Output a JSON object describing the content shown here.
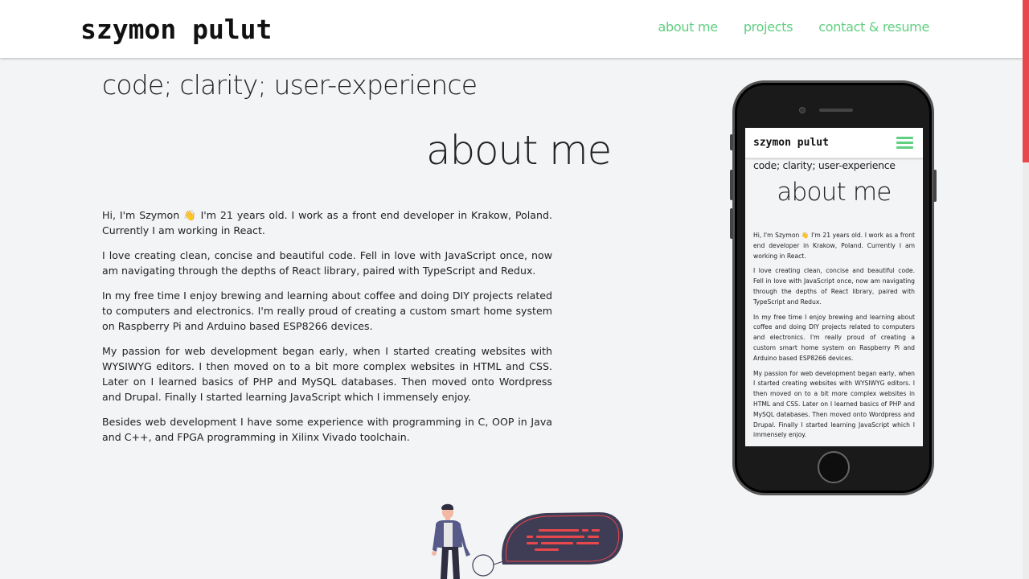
{
  "header": {
    "logo": "szymon pulut",
    "nav": [
      {
        "label": "about me"
      },
      {
        "label": "projects"
      },
      {
        "label": "contact & resume"
      }
    ]
  },
  "main": {
    "tagline": "code; clarity; user-experience",
    "section_title": "about me",
    "paragraphs": [
      "Hi, I'm Szymon 👋 I'm 21 years old. I work as a front end developer in Krakow, Poland. Currently I am working in React.",
      "I love creating clean, concise and beautiful code. Fell in love with JavaScript once, now am navigating through the depths of React library, paired with TypeScript and Redux.",
      "In my free time I enjoy brewing and learning about coffee and doing DIY projects related to computers and electronics. I'm really proud of creating a custom smart home system on Raspberry Pi and Arduino based ESP8266 devices.",
      "My passion for web development began early, when I started creating websites with WYSIWYG editors. I then moved on to a bit more complex websites in HTML and CSS. Later on I learned basics of PHP and MySQL databases. Then moved onto Wordpress and Drupal. Finally I started learning JavaScript which I immensely enjoy.",
      "Besides web development I have some experience with programming in C, OOP in Java and C++, and FPGA programming in Xilinx Vivado toolchain."
    ]
  },
  "phone": {
    "logo": "szymon pulut",
    "tagline": "code; clarity; user-experience",
    "section_title": "about me",
    "paragraphs": [
      "Hi, I'm Szymon 👋 I'm 21 years old. I work as a front end developer in Krakow, Poland. Currently I am working in React.",
      "I love creating clean, concise and beautiful code. Fell in love with JavaScript once, now am navigating through the depths of React library, paired with TypeScript and Redux.",
      "In my free time I enjoy brewing and learning about coffee and doing DIY projects related to computers and electronics. I'm really proud of creating a custom smart home system on Raspberry Pi and Arduino based ESP8266 devices.",
      "My passion for web development began early, when I started creating websites with WYSIWYG editors. I then moved on to a bit more complex websites in HTML and CSS. Later on I learned basics of PHP and MySQL databases. Then moved onto Wordpress and Drupal. Finally I started learning JavaScript which I immensely enjoy."
    ]
  },
  "colors": {
    "accent": "#5fcf80",
    "scroll_thumb": "#e8474b",
    "background": "#f3f4f6",
    "code_bubble": "#3f3d56",
    "code_lines": "#e8474b"
  },
  "icons": {
    "menu": "hamburger-menu-icon",
    "illustration": "developer-with-code-bubble-illustration"
  }
}
